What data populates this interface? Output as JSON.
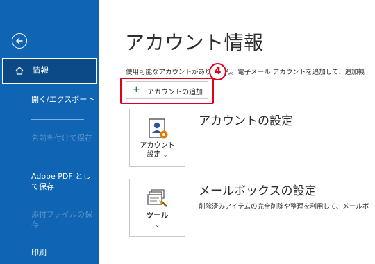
{
  "sidebar": {
    "items": [
      {
        "label": "情報"
      },
      {
        "label": "開く/エクスポート"
      },
      {
        "label": "名前を付けて保存"
      },
      {
        "label": "Adobe PDF として保存"
      },
      {
        "label": "添付ファイルの保存"
      },
      {
        "label": "印刷"
      }
    ]
  },
  "main": {
    "title": "アカウント情報",
    "description": "使用可能なアカウントがありません。電子メール アカウントを追加して、追加機",
    "add_account_label": "アカウントの追加",
    "step_number": "4",
    "account_settings": {
      "tile_line1": "アカウント",
      "tile_line2": "設定",
      "title": "アカウントの設定"
    },
    "mailbox_settings": {
      "tile_label": "ツール",
      "title": "メールボックスの設定",
      "description": "削除済みアイテムの完全削除や整理を利用して、メールボ"
    }
  },
  "colors": {
    "sidebar_bg": "#0f64b4",
    "sidebar_active_bg": "#0b4a86",
    "highlight": "#e0001a"
  }
}
